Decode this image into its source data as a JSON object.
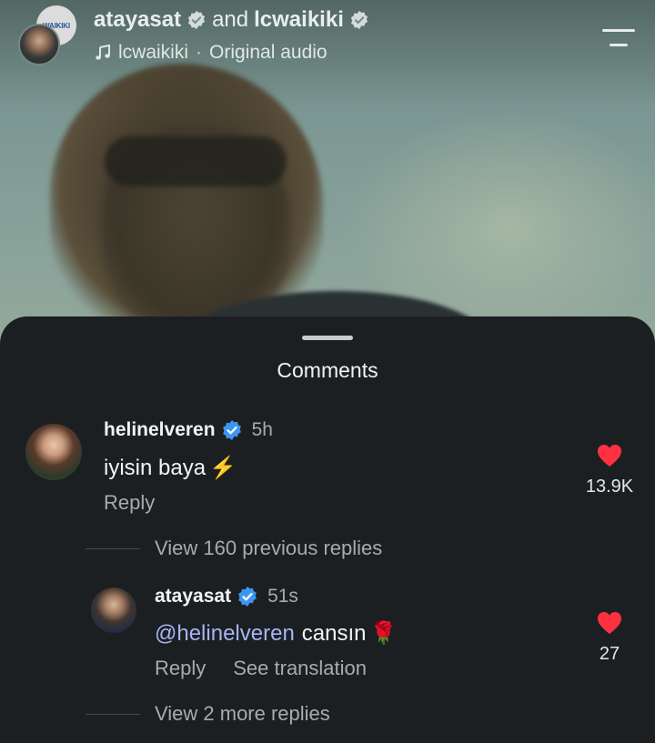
{
  "header": {
    "brand_avatar_text": "WAIKIKI",
    "user1": "atayasat",
    "joiner": "and",
    "user2": "lcwaikiki",
    "audio_account": "lcwaikiki",
    "audio_separator": "·",
    "audio_name": "Original audio"
  },
  "comments_panel": {
    "title": "Comments",
    "comments": [
      {
        "username": "helinelveren",
        "time": "5h",
        "text": "iyisin baya",
        "emoji": "⚡",
        "reply_label": "Reply",
        "like_count": "13.9K",
        "thread_link": "View 160 previous replies"
      },
      {
        "username": "atayasat",
        "time": "51s",
        "mention": "@helinelveren",
        "text": "cansın",
        "emoji": "🌹",
        "reply_label": "Reply",
        "translate_label": "See translation",
        "like_count": "27",
        "thread_link": "View 2 more replies"
      }
    ]
  },
  "colors": {
    "sheet_bg": "#1c1f22",
    "like_red": "#ff3040",
    "verified_blue": "#3b97f0",
    "mention_blue": "#a7b4f5",
    "muted_text": "#a7abb0"
  }
}
